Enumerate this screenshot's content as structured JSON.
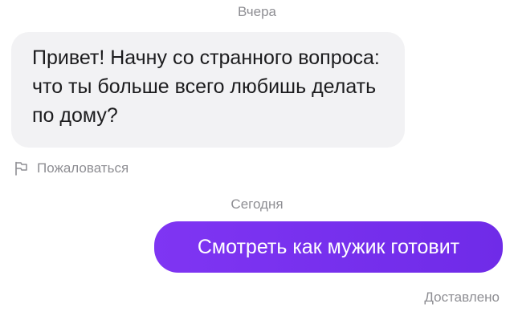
{
  "chat": {
    "dividers": {
      "yesterday": "Вчера",
      "today": "Сегодня"
    },
    "incoming_message": {
      "text": "Привет! Начну со странного вопроса: что ты больше всего любишь делать по дому?"
    },
    "report_link": {
      "icon": "flag-icon",
      "label": "Пожаловаться"
    },
    "outgoing_message": {
      "text": "Смотреть как мужик готовит",
      "status": "Доставлено"
    }
  },
  "colors": {
    "background": "#ffffff",
    "incoming_bubble": "#f2f2f4",
    "outgoing_bubble": "#7b2ff0",
    "muted_text": "#8e8e93",
    "primary_text": "#1c1c1e"
  }
}
